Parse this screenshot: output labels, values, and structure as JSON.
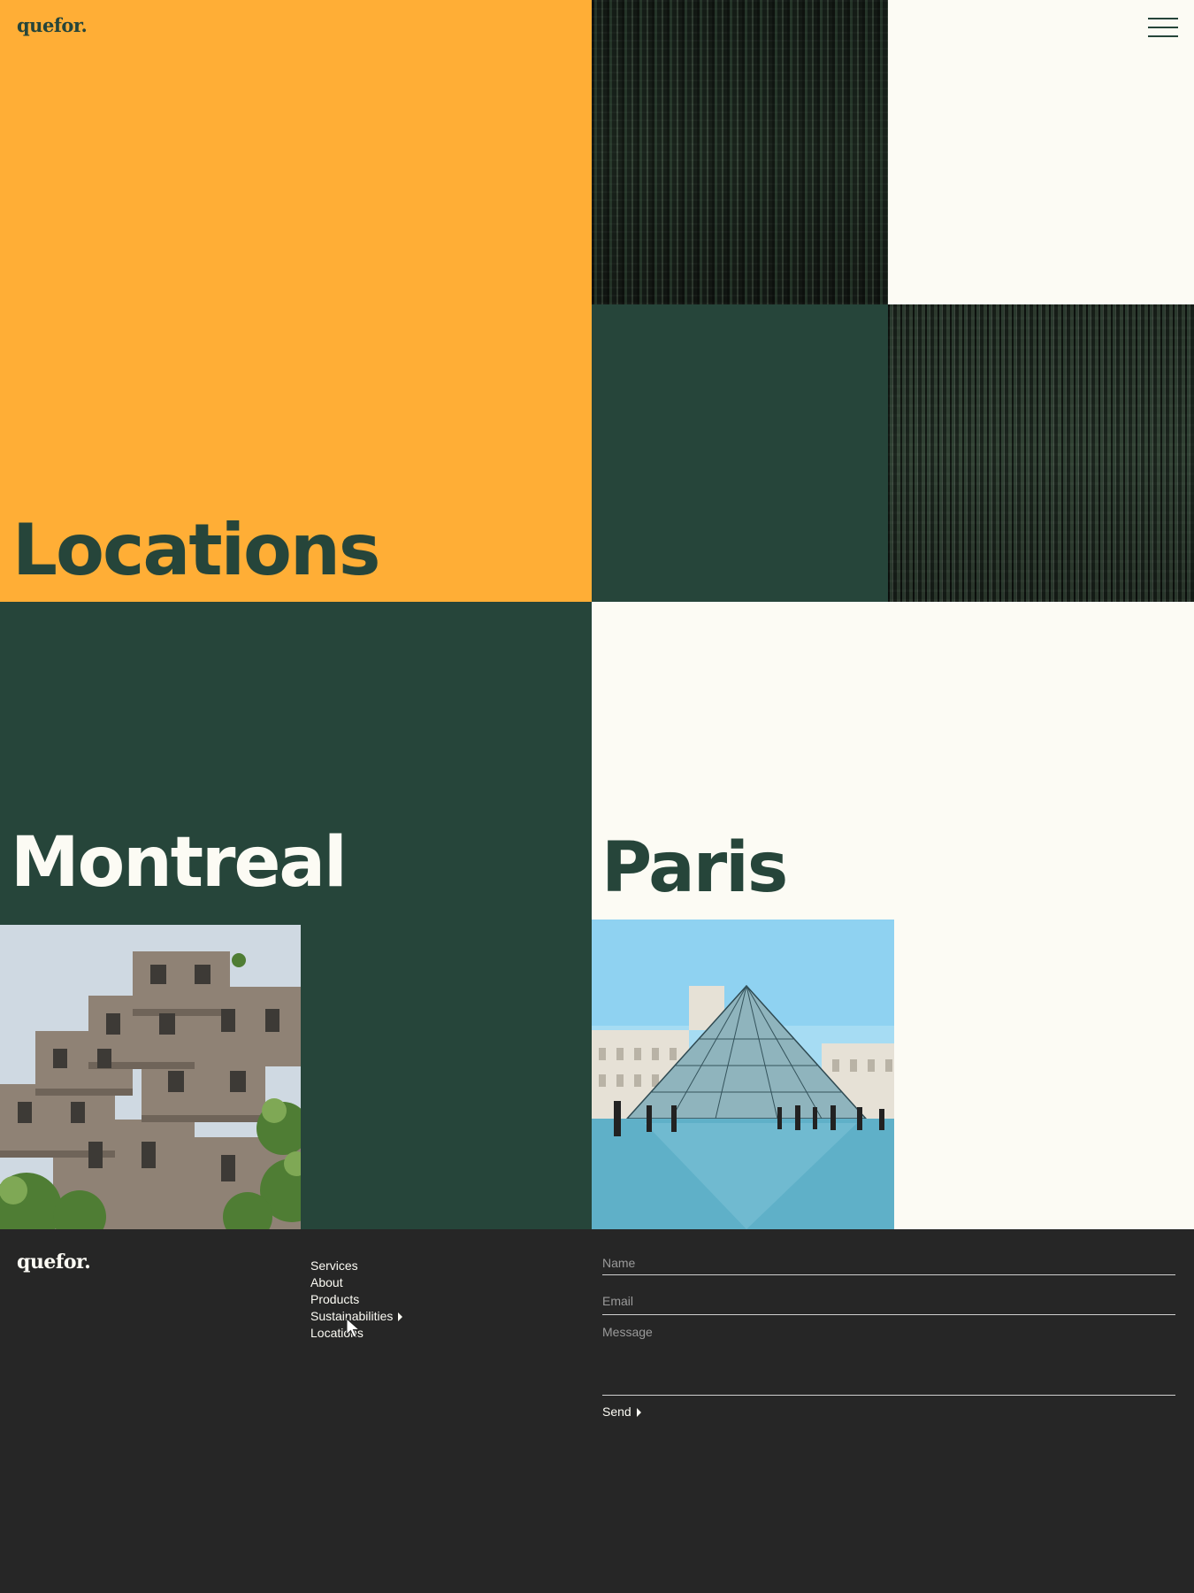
{
  "header": {
    "logo": "quefor.",
    "menu_icon": "hamburger-menu-icon"
  },
  "hero": {
    "title": "Locations",
    "images": [
      "pine-forest-photo",
      "pine-forest-photo"
    ]
  },
  "locations": [
    {
      "city": "Montreal",
      "image": "habitat-67-building-photo"
    },
    {
      "city": "Paris",
      "image": "louvre-pyramid-photo"
    }
  ],
  "footer": {
    "logo": "quefor.",
    "nav": [
      {
        "label": "Services"
      },
      {
        "label": "About"
      },
      {
        "label": "Products"
      },
      {
        "label": "Sustainabilities",
        "icon": "caret-right-icon"
      },
      {
        "label": "Locations"
      }
    ],
    "form": {
      "name_placeholder": "Name",
      "email_placeholder": "Email",
      "message_placeholder": "Message",
      "send_label": "Send",
      "send_icon": "caret-right-icon"
    }
  },
  "colors": {
    "orange": "#FFAE36",
    "dark_green": "#26453A",
    "cream": "#FCFBF4",
    "footer_bg": "#262626"
  }
}
